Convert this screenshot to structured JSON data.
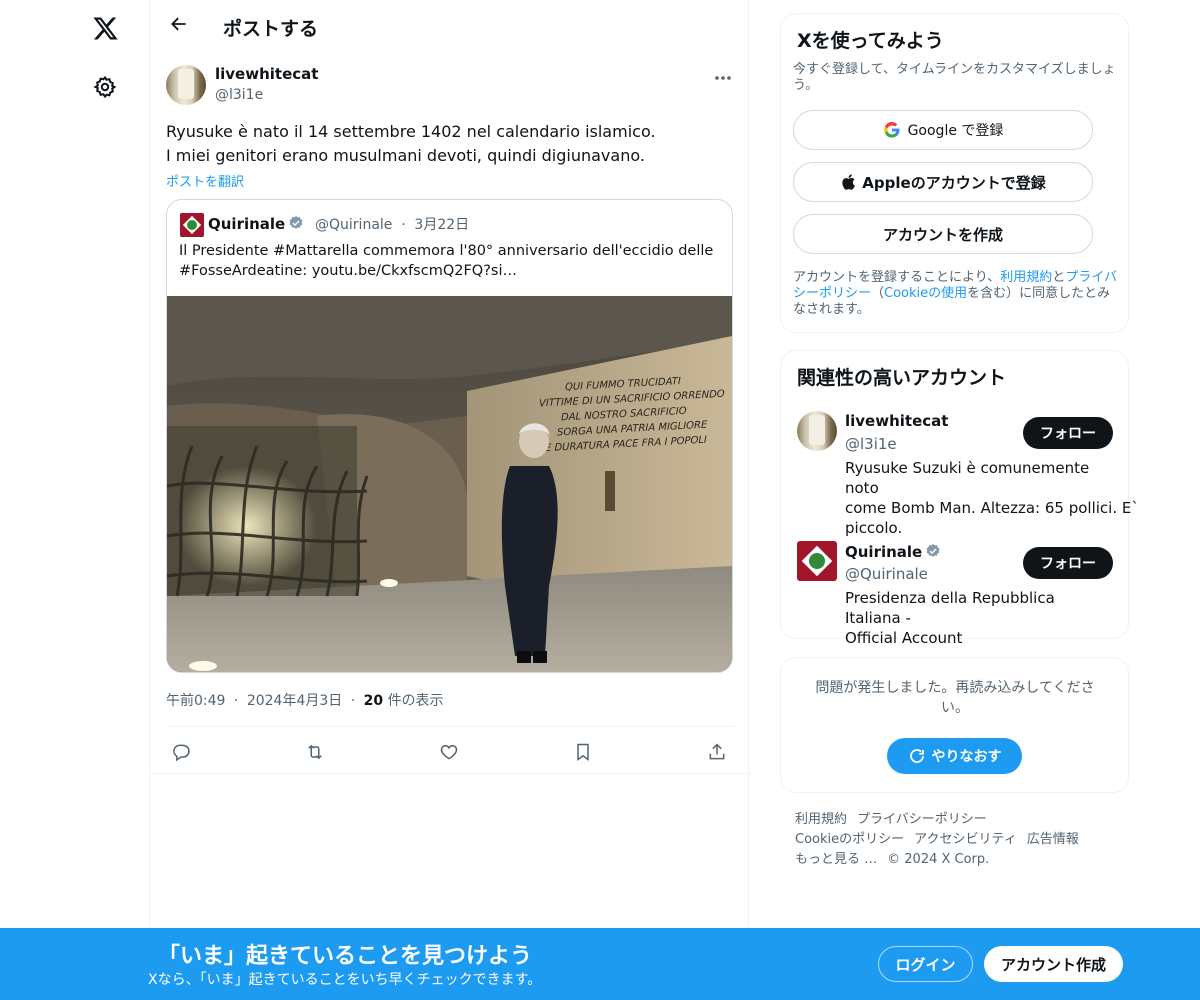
{
  "header": {
    "title": "ポストする"
  },
  "post": {
    "author_name": "livewhitecat",
    "author_handle": "@l3i1e",
    "text_line1": "Ryusuke è nato il 14 settembre 1402 nel calendario islamico.",
    "text_line2": "I miei genitori erano musulmani devoti, quindi digiunavano.",
    "translate_label": "ポストを翻訳",
    "time": "午前0:49",
    "date": "2024年4月3日",
    "views_count": "20",
    "views_label": "件の表示",
    "separator": "·"
  },
  "quote": {
    "author_name": "Quirinale",
    "author_handle": "@Quirinale",
    "separator": "·",
    "date": "3月22日",
    "text_line1": "Il Presidente #Mattarella commemora l'80° anniversario dell'eccidio delle",
    "text_line2": "#FosseArdeatine: youtu.be/CkxfscmQ2FQ?si…",
    "wall_inscription": [
      "QUI FUMMO TRUCIDATI",
      "VITTIME DI UN SACRIFICIO ORRENDO",
      "DAL NOSTRO SACRIFICIO",
      "SORGA UNA PATRIA MIGLIORE",
      "E DURATURA PACE FRA I POPOLI"
    ]
  },
  "signup_card": {
    "title": "Xを使ってみよう",
    "subtitle_line1": "今すぐ登録して、タイムラインをカスタマイズしましょ",
    "subtitle_line2": "う。",
    "google_button": "Google で登録",
    "apple_button": "Appleのアカウントで登録",
    "create_button": "アカウントを作成",
    "legal_part1": "アカウントを登録することにより、",
    "legal_terms": "利用規約",
    "legal_and": "と",
    "legal_privacy1": "プライバ",
    "legal_privacy2": "シーポリシー",
    "legal_paren_open": "（",
    "legal_cookie": "Cookieの使用",
    "legal_part2": "を含む）に同意したとみ",
    "legal_part3": "なされます。"
  },
  "relevant_card": {
    "title": "関連性の高いアカウント",
    "accounts": [
      {
        "name": "livewhitecat",
        "handle": "@l3i1e",
        "follow_label": "フォロー",
        "bio_line1": "Ryusuke Suzuki è comunemente noto",
        "bio_line2": "come Bomb Man. Altezza: 65 pollici. E`",
        "bio_line3": "piccolo."
      },
      {
        "name": "Quirinale",
        "handle": "@Quirinale",
        "follow_label": "フォロー",
        "bio_line1": "Presidenza della Repubblica Italiana -",
        "bio_line2": "Official Account"
      }
    ]
  },
  "error_card": {
    "message_line1": "問題が発生しました。再読み込みしてくださ",
    "message_line2": "い。",
    "retry_button": "やりなおす"
  },
  "footer": {
    "terms": "利用規約",
    "privacy": "プライバシーポリシー",
    "cookie": "Cookieのポリシー",
    "accessibility": "アクセシビリティ",
    "ads": "広告情報",
    "more": "もっと見る …",
    "copyright": "© 2024 X Corp."
  },
  "bottom_bar": {
    "title": "「いま」起きていることを見つけよう",
    "subtitle": "Xなら、「いま」起きていることをいち早くチェックできます。",
    "login_button": "ログイン",
    "signup_button": "アカウント作成"
  },
  "colors": {
    "accent": "#1d9bf0",
    "text_primary": "#0f1419",
    "text_secondary": "#536471",
    "border": "#cfd9de"
  },
  "icons": {
    "logo": "x-logo-icon",
    "settings": "gear-icon",
    "back": "arrow-left-icon",
    "more": "more-icon",
    "verified": "verified-badge-icon",
    "reply": "reply-icon",
    "repost": "repost-icon",
    "like": "heart-icon",
    "bookmark": "bookmark-icon",
    "share": "share-icon",
    "google": "google-icon",
    "apple": "apple-icon",
    "refresh": "refresh-icon"
  }
}
